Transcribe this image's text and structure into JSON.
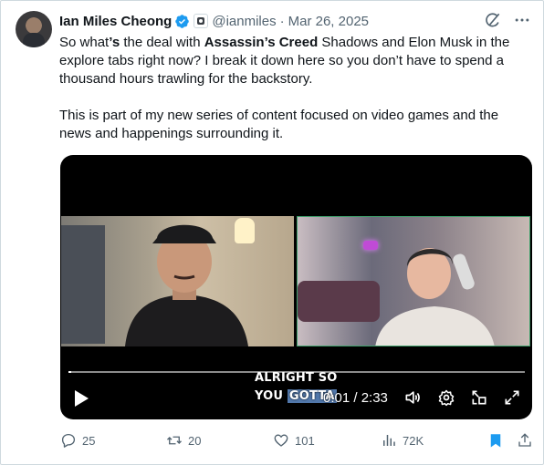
{
  "tweet": {
    "author_name": "Ian Miles Cheong",
    "handle": "@ianmiles",
    "separator": "·",
    "date": "Mar 26, 2025",
    "paragraph1_parts": [
      "So what",
      "’s",
      " the deal with ",
      "Assassin’s Creed",
      " Shadows and Elon Musk in the explore tabs right now? I break it down here so you don’t have to spend a thousand hours trawling for the backstory."
    ],
    "paragraph2": "This is part of my new series of content focused on video games and the news and happenings surrounding it."
  },
  "video": {
    "caption_line1": "ALRIGHT SO",
    "caption_line2_a": "YOU ",
    "caption_line2_b": "GOTTA",
    "time_display": "0:01 / 2:33",
    "progress_fraction": 0.0065
  },
  "actions": {
    "replies": "25",
    "reposts": "20",
    "likes": "101",
    "views": "72K"
  },
  "colors": {
    "accent": "#1d9bf0",
    "muted": "#536471",
    "text": "#0f1419"
  },
  "icons": {
    "verified": "verified-badge-icon",
    "grok": "grok-icon",
    "more": "more-icon",
    "reply": "reply-icon",
    "repost": "repost-icon",
    "like": "like-icon",
    "views": "views-icon",
    "bookmark": "bookmark-icon",
    "share": "share-icon",
    "play": "play-icon",
    "volume": "volume-icon",
    "settings": "settings-icon",
    "pip": "picture-in-picture-icon",
    "fullscreen": "fullscreen-icon"
  }
}
